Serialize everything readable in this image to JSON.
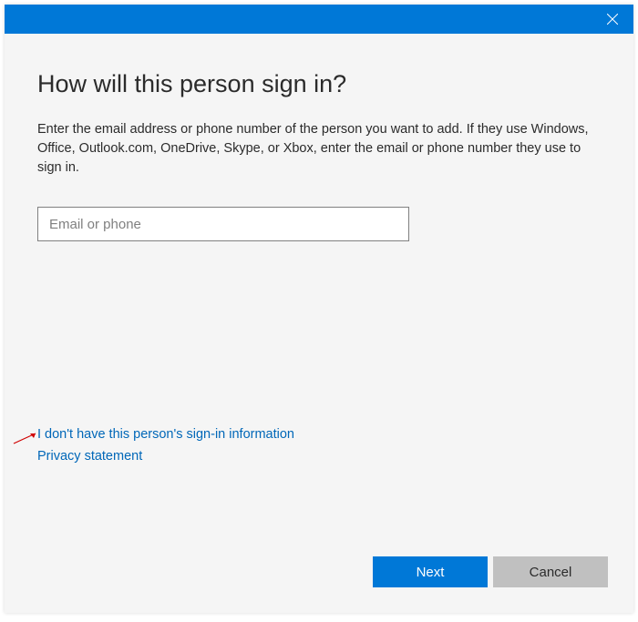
{
  "heading": "How will this person sign in?",
  "description": "Enter the email address or phone number of the person you want to add. If they use Windows, Office, Outlook.com, OneDrive, Skype, or Xbox, enter the email or phone number they use to sign in.",
  "input": {
    "placeholder": "Email or phone",
    "value": ""
  },
  "links": {
    "no_info": "I don't have this person's sign-in information",
    "privacy": "Privacy statement"
  },
  "buttons": {
    "next": "Next",
    "cancel": "Cancel"
  }
}
